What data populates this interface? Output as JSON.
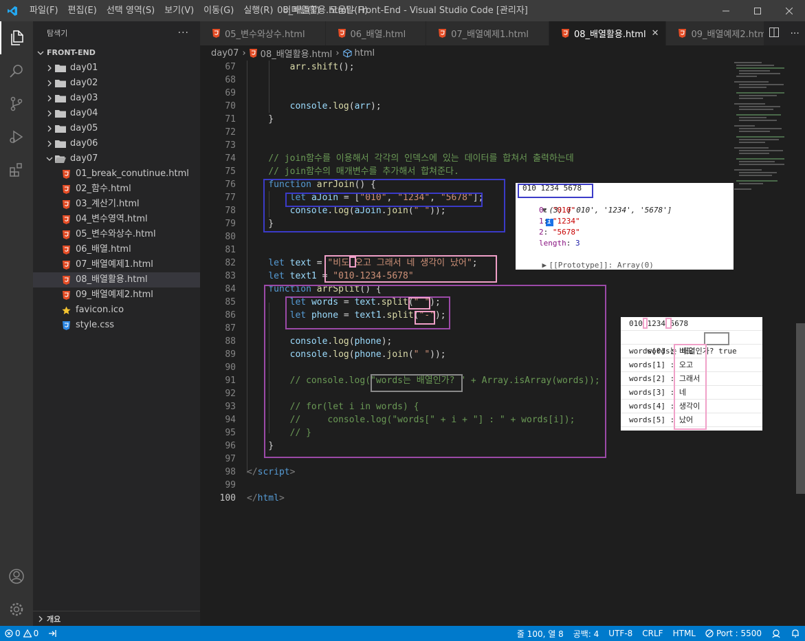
{
  "window": {
    "title": "08_배열활용.html - Front-End - Visual Studio Code [관리자]",
    "menus": [
      "파일(F)",
      "편집(E)",
      "선택 영역(S)",
      "보기(V)",
      "이동(G)",
      "실행(R)",
      "터미널(T)",
      "도움말(H)"
    ]
  },
  "activity_bar": {
    "items": [
      "explorer-icon",
      "search-icon",
      "source-control-icon",
      "run-debug-icon",
      "extensions-icon"
    ],
    "bottom": [
      "account-icon",
      "settings-gear-icon"
    ]
  },
  "sidebar": {
    "header": "탐색기",
    "more": "···",
    "section": "FRONT-END",
    "folders": [
      "day01",
      "day02",
      "day03",
      "day04",
      "day05",
      "day06"
    ],
    "open_folder": "day07",
    "files": [
      {
        "name": "01_break_conutinue.html",
        "type": "html"
      },
      {
        "name": "02_함수.html",
        "type": "html"
      },
      {
        "name": "03_계산기.html",
        "type": "html"
      },
      {
        "name": "04_변수영역.html",
        "type": "html"
      },
      {
        "name": "05_변수와상수.html",
        "type": "html"
      },
      {
        "name": "06_배열.html",
        "type": "html"
      },
      {
        "name": "07_배열예제1.html",
        "type": "html"
      },
      {
        "name": "08_배열활용.html",
        "type": "html"
      },
      {
        "name": "09_배열예제2.html",
        "type": "html"
      },
      {
        "name": "favicon.ico",
        "type": "star"
      },
      {
        "name": "style.css",
        "type": "css"
      }
    ],
    "outline": "개요"
  },
  "tabs": [
    {
      "label": "05_변수와상수.html",
      "active": false
    },
    {
      "label": "06_배열.html",
      "active": false
    },
    {
      "label": "07_배열예제1.html",
      "active": false
    },
    {
      "label": "08_배열활용.html",
      "active": true
    },
    {
      "label": "09_배열예제2.html",
      "active": false
    }
  ],
  "breadcrumb": [
    "day07",
    "08_배열활용.html",
    "html"
  ],
  "editor": {
    "line_start": 67,
    "current_line": 100,
    "lines": [
      [
        [
          "",
          "        "
        ],
        [
          "f",
          "arr.shift"
        ],
        [
          "",
          "();"
        ]
      ],
      [],
      [],
      [
        [
          "",
          "        "
        ],
        [
          "v",
          "console"
        ],
        [
          "",
          "."
        ],
        [
          "f",
          "log"
        ],
        [
          "",
          "("
        ],
        [
          "v",
          "arr"
        ],
        [
          "",
          ");"
        ]
      ],
      [
        [
          "",
          "    }"
        ]
      ],
      [],
      [],
      [
        [
          "",
          "    "
        ],
        [
          "c",
          "// join함수를 이용해서 각각의 인덱스에 있는 데이터를 합쳐서 출력하는데"
        ]
      ],
      [
        [
          "",
          "    "
        ],
        [
          "c",
          "// join함수의 매개변수를 추가해서 합쳐준다."
        ]
      ],
      [
        [
          "",
          "    "
        ],
        [
          "k",
          "function"
        ],
        [
          "",
          " "
        ],
        [
          "f",
          "arrJoin"
        ],
        [
          "",
          "() {"
        ]
      ],
      [
        [
          "",
          "        "
        ],
        [
          "k",
          "let"
        ],
        [
          "",
          " "
        ],
        [
          "v",
          "aJoin"
        ],
        [
          "",
          " = ["
        ],
        [
          "s",
          "\"010\""
        ],
        [
          "",
          ", "
        ],
        [
          "s",
          "\"1234\""
        ],
        [
          "",
          ", "
        ],
        [
          "s",
          "\"5678\""
        ],
        [
          "",
          "];"
        ]
      ],
      [
        [
          "",
          "        "
        ],
        [
          "v",
          "console"
        ],
        [
          "",
          "."
        ],
        [
          "f",
          "log"
        ],
        [
          "",
          "("
        ],
        [
          "v",
          "aJoin"
        ],
        [
          "",
          "."
        ],
        [
          "f",
          "join"
        ],
        [
          "",
          "("
        ],
        [
          "s",
          "\" \""
        ],
        [
          "",
          "));"
        ]
      ],
      [
        [
          "",
          "    }"
        ]
      ],
      [],
      [],
      [
        [
          "",
          "    "
        ],
        [
          "k",
          "let"
        ],
        [
          "",
          " "
        ],
        [
          "v",
          "text"
        ],
        [
          "",
          " = "
        ],
        [
          "s",
          "\"비도 오고 그래서 네 생각이 났어\""
        ],
        [
          "",
          ";"
        ]
      ],
      [
        [
          "",
          "    "
        ],
        [
          "k",
          "let"
        ],
        [
          "",
          " "
        ],
        [
          "v",
          "text1"
        ],
        [
          "",
          " = "
        ],
        [
          "s",
          "\"010-1234-5678\""
        ]
      ],
      [
        [
          "",
          "    "
        ],
        [
          "k",
          "function"
        ],
        [
          "",
          " "
        ],
        [
          "f",
          "arrSplit"
        ],
        [
          "",
          "() {"
        ]
      ],
      [
        [
          "",
          "        "
        ],
        [
          "k",
          "let"
        ],
        [
          "",
          " "
        ],
        [
          "v",
          "words"
        ],
        [
          "",
          " = "
        ],
        [
          "v",
          "text"
        ],
        [
          "",
          "."
        ],
        [
          "f",
          "split"
        ],
        [
          "",
          "("
        ],
        [
          "s",
          "\" \""
        ],
        [
          "",
          ");"
        ]
      ],
      [
        [
          "",
          "        "
        ],
        [
          "k",
          "let"
        ],
        [
          "",
          " "
        ],
        [
          "v",
          "phone"
        ],
        [
          "",
          " = "
        ],
        [
          "v",
          "text1"
        ],
        [
          "",
          "."
        ],
        [
          "f",
          "split"
        ],
        [
          "",
          "("
        ],
        [
          "s",
          "\"-\""
        ],
        [
          "",
          ");"
        ]
      ],
      [],
      [
        [
          "",
          "        "
        ],
        [
          "v",
          "console"
        ],
        [
          "",
          "."
        ],
        [
          "f",
          "log"
        ],
        [
          "",
          "("
        ],
        [
          "v",
          "phone"
        ],
        [
          "",
          ");"
        ]
      ],
      [
        [
          "",
          "        "
        ],
        [
          "v",
          "console"
        ],
        [
          "",
          "."
        ],
        [
          "f",
          "log"
        ],
        [
          "",
          "("
        ],
        [
          "v",
          "phone"
        ],
        [
          "",
          "."
        ],
        [
          "f",
          "join"
        ],
        [
          "",
          "("
        ],
        [
          "s",
          "\" \""
        ],
        [
          "",
          "));"
        ]
      ],
      [],
      [
        [
          "",
          "        "
        ],
        [
          "c",
          "// console.log(\"words는 배열인가? \" + Array.isArray(words));"
        ]
      ],
      [],
      [
        [
          "",
          "        "
        ],
        [
          "c",
          "// for(let i in words) {"
        ]
      ],
      [
        [
          "",
          "        "
        ],
        [
          "c",
          "//     console.log(\"words[\" + i + \"] : \" + words[i]);"
        ]
      ],
      [
        [
          "",
          "        "
        ],
        [
          "c",
          "// }"
        ]
      ],
      [
        [
          "",
          "    }"
        ]
      ],
      [],
      [
        [
          "t",
          "</"
        ],
        [
          "tg",
          "script"
        ],
        [
          "t",
          ">"
        ]
      ],
      [],
      [
        [
          "t",
          "</"
        ],
        [
          "tg",
          "html"
        ],
        [
          "t",
          ">"
        ]
      ]
    ]
  },
  "console_join": {
    "output": "010 1234 5678",
    "array_summary": "(3) ['010', '1234', '5678']",
    "info_badge": "i",
    "entries": [
      {
        "key": "0",
        "value": "\"010\""
      },
      {
        "key": "1",
        "value": "\"1234\""
      },
      {
        "key": "2",
        "value": "\"5678\""
      },
      {
        "key": "length",
        "value": "3"
      }
    ],
    "prototype": "[[Prototype]]: Array(0)"
  },
  "console_split": {
    "phone_output": "010 1234 5678",
    "is_array_label": "words는 배열인가? ",
    "is_array_value": "true",
    "words": [
      {
        "key": "words[0] : ",
        "value": "비도"
      },
      {
        "key": "words[1] : ",
        "value": "오고"
      },
      {
        "key": "words[2] : ",
        "value": "그래서"
      },
      {
        "key": "words[3] : ",
        "value": "네"
      },
      {
        "key": "words[4] : ",
        "value": "생각이"
      },
      {
        "key": "words[5] : ",
        "value": "났어"
      }
    ]
  },
  "statusbar": {
    "errors": "0",
    "warnings": "0",
    "position": "줄 100, 열 8",
    "spaces": "공백: 4",
    "encoding": "UTF-8",
    "eol": "CRLF",
    "language": "HTML",
    "port": "Port : 5500"
  },
  "colors": {
    "accent": "#007acc",
    "annotation_blue": "#3b3bc8",
    "annotation_pink": "#f0a0c8",
    "annotation_purple": "#9c4aa8",
    "annotation_gray": "#8a8a8a"
  }
}
